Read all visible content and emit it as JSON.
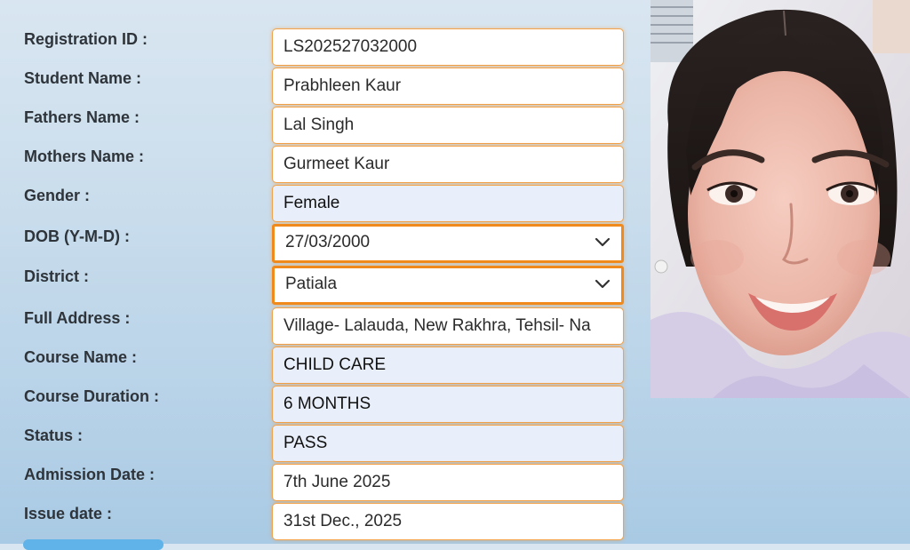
{
  "form": {
    "rows": [
      {
        "label": "Registration ID :",
        "value": "LS202527032000",
        "kind": "input"
      },
      {
        "label": "Student Name :",
        "value": "Prabhleen Kaur",
        "kind": "input"
      },
      {
        "label": "Fathers Name :",
        "value": "Lal Singh",
        "kind": "input"
      },
      {
        "label": "Mothers Name :",
        "value": "Gurmeet Kaur",
        "kind": "input"
      },
      {
        "label": "Gender :",
        "value": "Female",
        "kind": "readonly"
      },
      {
        "label": "DOB (Y-M-D) :",
        "value": "27/03/2000",
        "kind": "select"
      },
      {
        "label": "District :",
        "value": "Patiala",
        "kind": "select"
      },
      {
        "label": "Full Address :",
        "value": "Village- Lalauda, New Rakhra, Tehsil- Na",
        "kind": "input"
      },
      {
        "label": "Course Name :",
        "value": "CHILD CARE",
        "kind": "readonly"
      },
      {
        "label": "Course Duration :",
        "value": "6 MONTHS",
        "kind": "readonly"
      },
      {
        "label": "Status :",
        "value": "PASS",
        "kind": "readonly"
      },
      {
        "label": "Admission Date :",
        "value": "7th June 2025",
        "kind": "input"
      },
      {
        "label": "Issue date :",
        "value": "31st Dec., 2025",
        "kind": "input"
      }
    ]
  },
  "photo": {
    "icon": "student-photo"
  },
  "colors": {
    "accent_orange": "#f08a1c",
    "field_border": "#f3a24a",
    "readonly_bg": "#e9effa",
    "label_text": "#2e343a"
  }
}
